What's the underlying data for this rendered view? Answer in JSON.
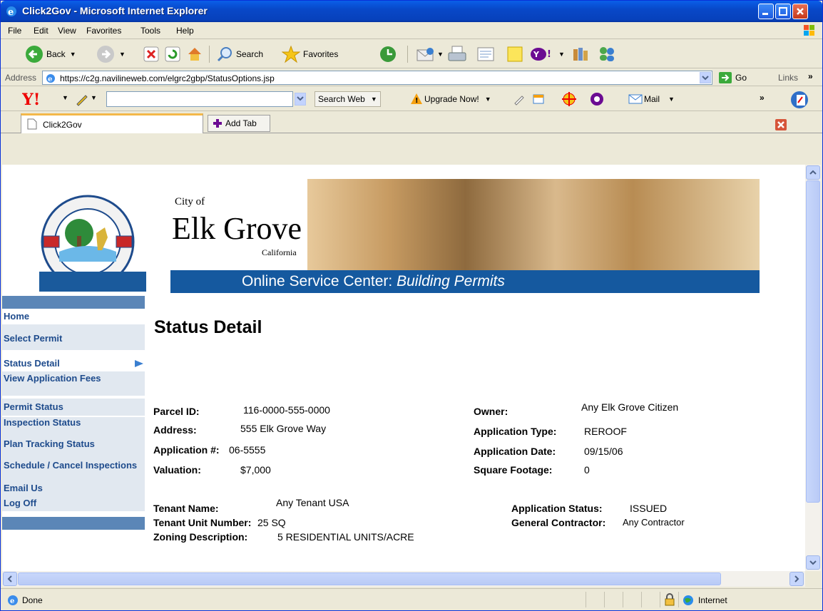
{
  "window": {
    "title": "Click2Gov - Microsoft Internet Explorer"
  },
  "menu": [
    "File",
    "Edit",
    "View",
    "Favorites",
    "Tools",
    "Help"
  ],
  "toolbar": {
    "back": "Back",
    "search": "Search",
    "favorites": "Favorites"
  },
  "address": {
    "label": "Address",
    "url": "https://c2g.navilineweb.com/elgrc2gbp/StatusOptions.jsp",
    "go": "Go",
    "links": "Links"
  },
  "yahoo": {
    "search_web": "Search Web",
    "upgrade": "Upgrade Now!",
    "mail": "Mail"
  },
  "tabs": {
    "current": "Click2Gov",
    "add": "Add Tab"
  },
  "banner": {
    "city_of": "City of",
    "city": "Elk Grove",
    "state": "California",
    "service": "Online Service Center: ",
    "service_italic": "Building Permits"
  },
  "nav": [
    {
      "label": "Home"
    },
    {
      "label": "Select Permit"
    },
    {
      "label": "Status Detail"
    },
    {
      "label": "View Application Fees"
    },
    {
      "label": "Permit Status"
    },
    {
      "label": "Inspection Status"
    },
    {
      "label": "Plan Tracking Status"
    },
    {
      "label": "Schedule / Cancel Inspections"
    },
    {
      "label": "Email Us"
    },
    {
      "label": "Log Off"
    }
  ],
  "page": {
    "heading": "Status Detail"
  },
  "details": {
    "parcel_label": "Parcel ID:",
    "parcel": "116-0000-555-0000",
    "address_label": "Address:",
    "address": "555 Elk Grove Way",
    "app_no_label": "Application #:",
    "app_no": "06-5555",
    "valuation_label": "Valuation:",
    "valuation": "$7,000",
    "owner_label": "Owner:",
    "owner": "Any Elk Grove Citizen",
    "app_type_label": "Application Type:",
    "app_type": "REROOF",
    "app_date_label": "Application Date:",
    "app_date": "09/15/06",
    "sqft_label": "Square Footage:",
    "sqft": "0",
    "tenant_label": "Tenant Name:",
    "tenant": "Any Tenant USA",
    "unit_label": "Tenant Unit Number:",
    "unit": "25 SQ",
    "zoning_label": "Zoning Description:",
    "zoning": "5 RESIDENTIAL UNITS/ACRE",
    "status_label": "Application Status:",
    "status": "ISSUED",
    "contractor_label": "General Contractor:",
    "contractor": "Any Contractor"
  },
  "statusbar": {
    "text": "Done",
    "zone": "Internet"
  }
}
